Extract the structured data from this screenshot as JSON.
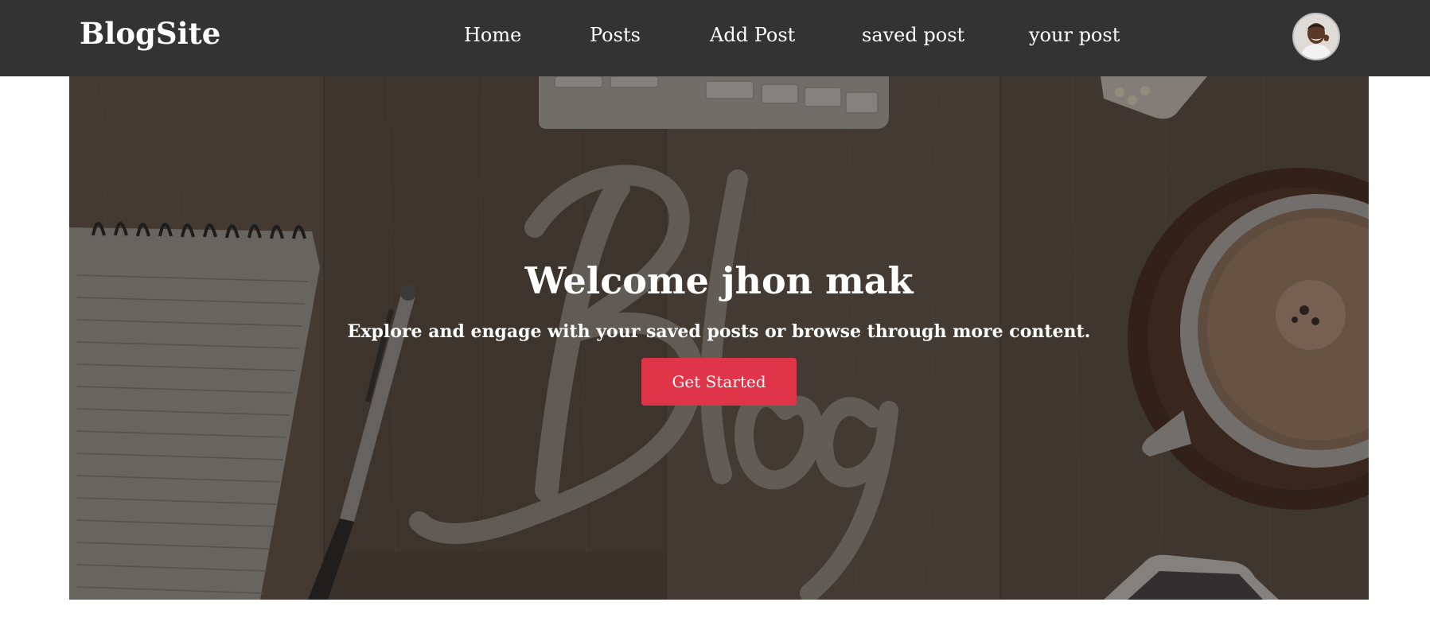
{
  "navbar": {
    "brand": "BlogSite",
    "links": [
      {
        "label": "Home"
      },
      {
        "label": "Posts"
      },
      {
        "label": "Add Post"
      },
      {
        "label": "saved post"
      },
      {
        "label": "your post"
      }
    ],
    "avatar_icon": "user-avatar-icon"
  },
  "hero": {
    "title": "Welcome jhon mak",
    "subtitle": "Explore and engage with your saved posts or browse through more content.",
    "cta_label": "Get Started",
    "background_icon": "blog-desk-background"
  },
  "colors": {
    "navbar_bg": "#333333",
    "accent": "#e03548",
    "text_light": "#ffffff"
  }
}
